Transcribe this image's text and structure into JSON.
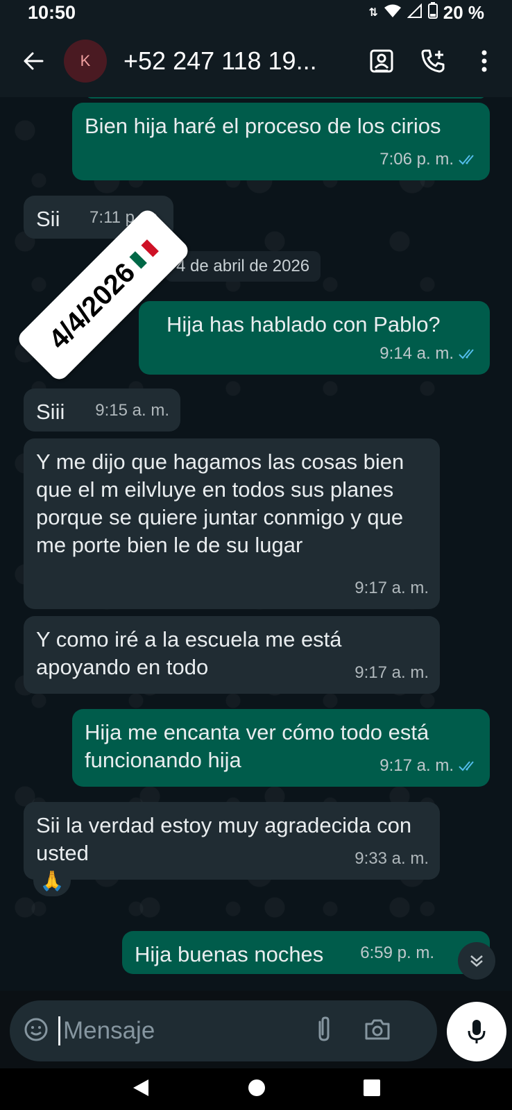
{
  "status_bar": {
    "time": "10:50",
    "battery": "20 %"
  },
  "header": {
    "avatar_letter": "K",
    "contact_name": "+52 247 118 19..."
  },
  "messages": [
    {
      "dir": "out",
      "text": "Bien hija haré el proceso de los cirios",
      "time": "7:06 p. m."
    },
    {
      "dir": "in",
      "text": "Sii",
      "time": "7:11 p. m."
    },
    {
      "dir": "out",
      "text": "Hija has hablado con Pablo?",
      "time": "9:14 a. m."
    },
    {
      "dir": "in",
      "text": "Siii",
      "time": "9:15 a. m."
    },
    {
      "dir": "in",
      "text": "Y me dijo que hagamos las cosas bien que el m eilvluye en todos sus planes porque se quiere juntar conmigo y que me porte bien le de su lugar",
      "time": "9:17 a. m."
    },
    {
      "dir": "in",
      "text": "Y como iré a la escuela me está apoyando en todo",
      "time": "9:17 a. m."
    },
    {
      "dir": "out",
      "text": "Hija me encanta ver cómo todo está funcionando hija",
      "time": "9:17 a. m."
    },
    {
      "dir": "in",
      "text": "Sii la verdad estoy muy agradecida con usted",
      "time": "9:33 a. m."
    },
    {
      "dir": "out",
      "text": "Hija buenas noches",
      "time": "6:59 p. m."
    }
  ],
  "date_separator": "4 de abril de 2026",
  "sticker": {
    "text": "4/4/2026"
  },
  "reaction": {
    "emoji": "🙏"
  },
  "composer": {
    "placeholder": "Mensaje"
  },
  "colors": {
    "out_bubble": "#005c4b",
    "in_bubble": "#202c33",
    "background": "#0b141a",
    "read_tick": "#53bdeb"
  }
}
